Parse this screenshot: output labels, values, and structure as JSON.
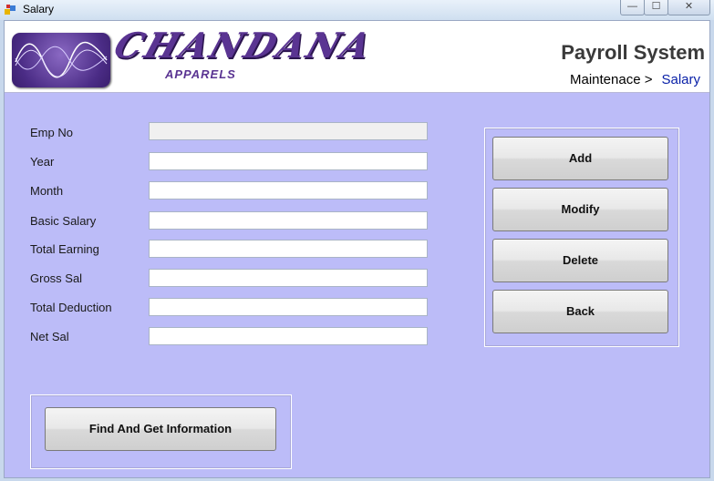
{
  "window": {
    "title": "Salary",
    "minimize": "—",
    "maximize": "☐",
    "close": "✕"
  },
  "banner": {
    "brand": "CHANDANA",
    "brand_sub": "APPARELS",
    "app_title": "Payroll System",
    "breadcrumb": {
      "parent": "Maintenace >",
      "current": "Salary"
    }
  },
  "form": {
    "fields": [
      {
        "label": "Emp No",
        "value": "",
        "readonly": true
      },
      {
        "label": "Year",
        "value": ""
      },
      {
        "label": "Month",
        "value": ""
      },
      {
        "label": "Basic Salary",
        "value": ""
      },
      {
        "label": "Total Earning",
        "value": ""
      },
      {
        "label": "Gross Sal",
        "value": ""
      },
      {
        "label": "Total Deduction",
        "value": ""
      },
      {
        "label": "Net Sal",
        "value": ""
      }
    ]
  },
  "actions": {
    "add": "Add",
    "modify": "Modify",
    "delete": "Delete",
    "back": "Back"
  },
  "find": {
    "label": "Find And Get Information"
  },
  "colors": {
    "client_bg": "#bcbcf8",
    "brand_purple": "#5a3492",
    "breadcrumb_active": "#0a21a8"
  }
}
